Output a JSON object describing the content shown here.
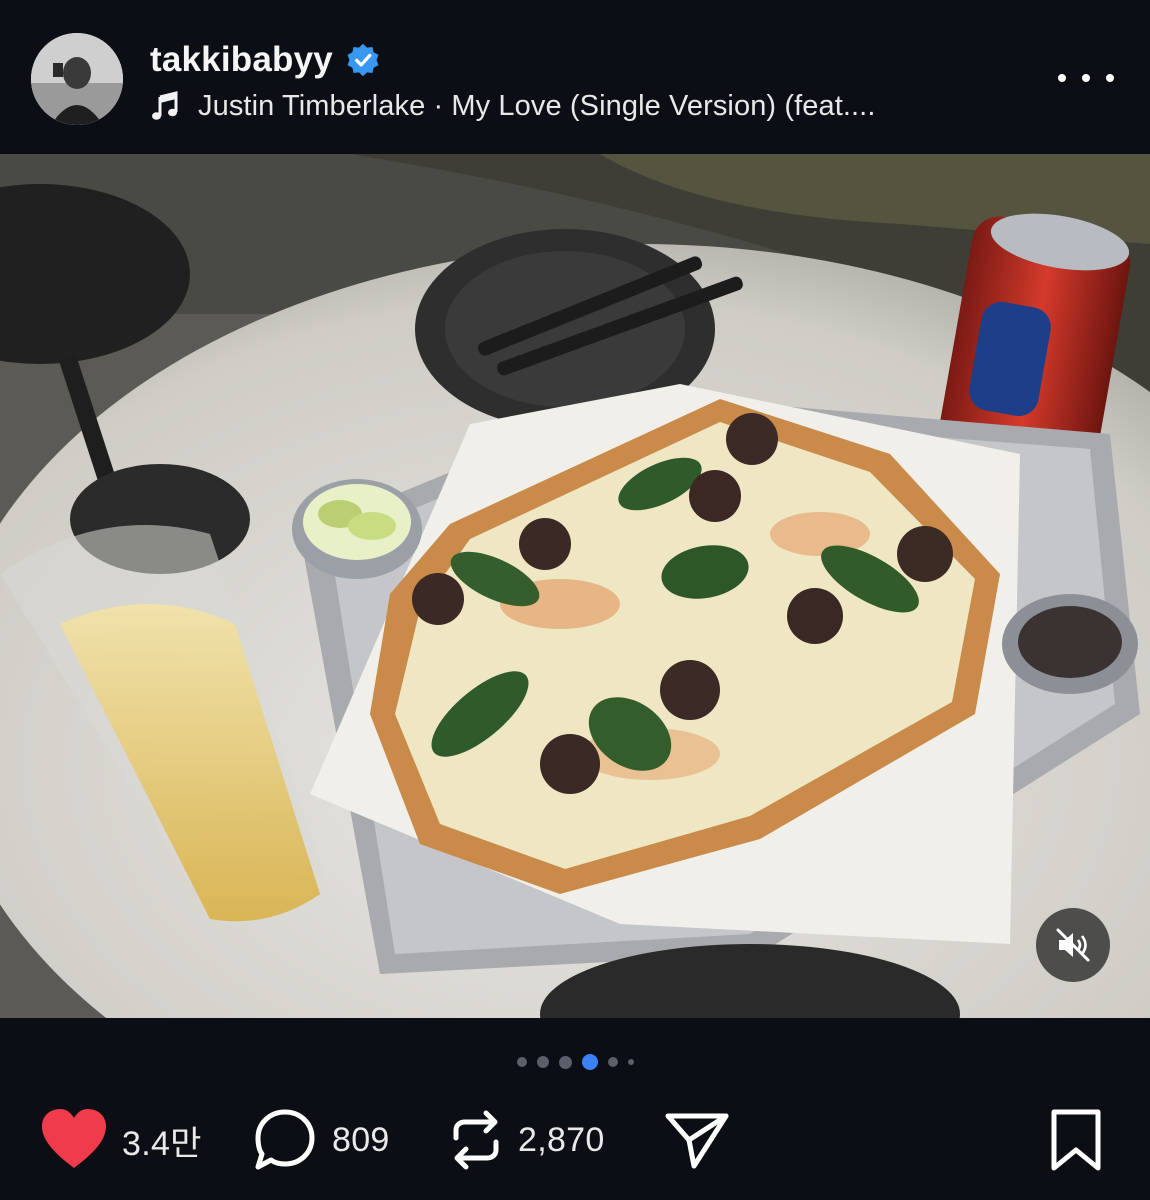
{
  "post": {
    "username": "takkibabyy",
    "verified": true,
    "music": "Justin Timberlake · My Love (Single Version) (feat...."
  },
  "media": {
    "description_icon": "photo",
    "mute_icon": "speaker-muted-icon",
    "carousel": {
      "total": 6,
      "current": 4
    }
  },
  "actions": {
    "likes": "3.4만",
    "comments": "809",
    "reposts": "2,870"
  },
  "colors": {
    "background": "#0b0e14",
    "like": "#f03b4b",
    "verified": "#3897f0",
    "active_dot": "#3b82f6"
  }
}
